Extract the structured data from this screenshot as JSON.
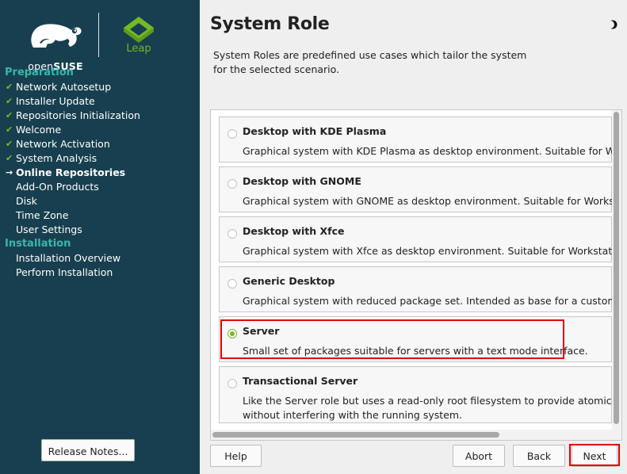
{
  "sidebar": {
    "brand": {
      "open": "open",
      "suse": "SUSE",
      "product": "Leap"
    },
    "sections": [
      {
        "title": "Preparation",
        "steps": [
          {
            "label": "Network Autosetup",
            "state": "done"
          },
          {
            "label": "Installer Update",
            "state": "done"
          },
          {
            "label": "Repositories Initialization",
            "state": "done"
          },
          {
            "label": "Welcome",
            "state": "done"
          },
          {
            "label": "Network Activation",
            "state": "done"
          },
          {
            "label": "System Analysis",
            "state": "done"
          },
          {
            "label": "Online Repositories",
            "state": "current"
          },
          {
            "label": "Add-On Products",
            "state": "pending"
          },
          {
            "label": "Disk",
            "state": "pending"
          },
          {
            "label": "Time Zone",
            "state": "pending"
          },
          {
            "label": "User Settings",
            "state": "pending"
          }
        ]
      },
      {
        "title": "Installation",
        "steps": [
          {
            "label": "Installation Overview",
            "state": "pending"
          },
          {
            "label": "Perform Installation",
            "state": "pending"
          }
        ]
      }
    ],
    "release_notes_label": "Release Notes..."
  },
  "main": {
    "title": "System Role",
    "description_lines": [
      "System Roles are predefined use cases which tailor the system",
      "for the selected scenario."
    ],
    "roles": [
      {
        "title": "Desktop with KDE Plasma",
        "description": [
          "Graphical system with KDE Plasma as desktop environment. Suitable for Workstations, Desktops and"
        ],
        "selected": false
      },
      {
        "title": "Desktop with GNOME",
        "description": [
          "Graphical system with GNOME as desktop environment. Suitable for Workstations, Desktops and"
        ],
        "selected": false
      },
      {
        "title": "Desktop with Xfce",
        "description": [
          "Graphical system with Xfce as desktop environment. Suitable for Workstations, Desktops and"
        ],
        "selected": false
      },
      {
        "title": "Generic Desktop",
        "description": [
          "Graphical system with reduced package set. Intended as base for a customized solution."
        ],
        "selected": false
      },
      {
        "title": "Server",
        "description": [
          "Small set of packages suitable for servers with a text mode interface."
        ],
        "selected": true
      },
      {
        "title": "Transactional Server",
        "description": [
          "Like the Server role but uses a read-only root filesystem to provide atomic, automatic updates",
          "without interfering with the running system."
        ],
        "selected": false
      }
    ]
  },
  "buttons": {
    "help": "Help",
    "abort": "Abort",
    "back": "Back",
    "next": "Next"
  },
  "colors": {
    "sidebar_bg": "#173f4f",
    "section_accent": "#35b9ab",
    "check_green": "#73ba25",
    "highlight_red": "#e00000"
  },
  "icons": {
    "done": "checkmark-icon",
    "current": "arrow-right-icon",
    "theme": "half-moon-icon"
  }
}
